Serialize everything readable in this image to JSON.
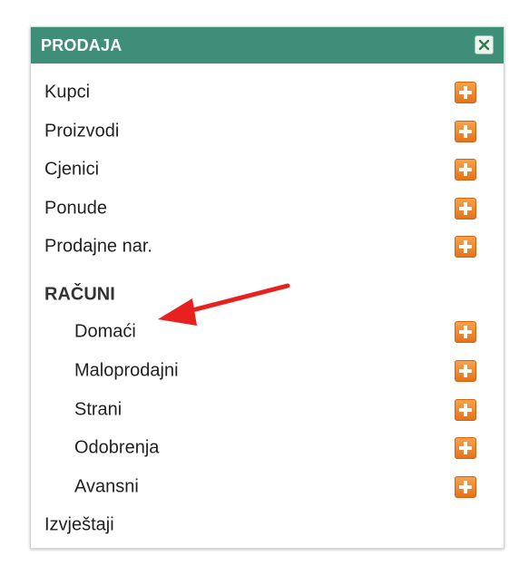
{
  "panel": {
    "title": "PRODAJA",
    "close_icon": "close-icon"
  },
  "menu": {
    "items": [
      {
        "label": "Kupci",
        "has_add": true
      },
      {
        "label": "Proizvodi",
        "has_add": true
      },
      {
        "label": "Cjenici",
        "has_add": true
      },
      {
        "label": "Ponude",
        "has_add": true
      },
      {
        "label": "Prodajne nar.",
        "has_add": true
      }
    ],
    "section": {
      "label": "RAČUNI",
      "items": [
        {
          "label": "Domaći",
          "has_add": true
        },
        {
          "label": "Maloprodajni",
          "has_add": true
        },
        {
          "label": "Strani",
          "has_add": true
        },
        {
          "label": "Odobrenja",
          "has_add": true
        },
        {
          "label": "Avansni",
          "has_add": true
        }
      ]
    },
    "footer_item": {
      "label": "Izvještaji"
    }
  },
  "colors": {
    "header_bg": "#3f8f78",
    "add_button": "#f08a2e",
    "annotation_arrow": "#e8201e"
  },
  "annotation": {
    "type": "arrow",
    "points_to": "Domaći"
  }
}
